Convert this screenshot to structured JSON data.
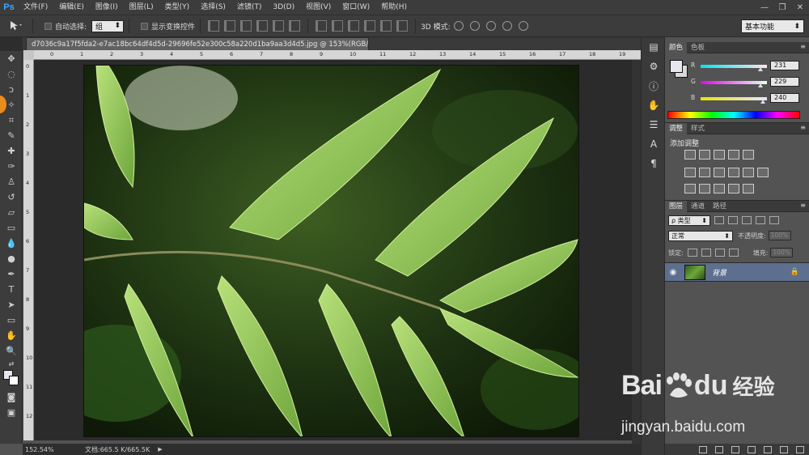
{
  "app": {
    "logo": "Ps",
    "menu": [
      "文件(F)",
      "编辑(E)",
      "图像(I)",
      "图层(L)",
      "类型(Y)",
      "选择(S)",
      "滤镜(T)",
      "3D(D)",
      "视图(V)",
      "窗口(W)",
      "帮助(H)"
    ],
    "window_controls": [
      "—",
      "❐",
      "✕"
    ]
  },
  "options_bar": {
    "auto_select_label": "自动选择:",
    "auto_select_value": "组",
    "show_transform_label": "显示变换控件",
    "mode_3d_label": "3D 模式:",
    "workspace": "基本功能"
  },
  "document": {
    "tab_title": "d7036c9a17f5fda2-e7ac18bc64df4d5d-29696fe52e300c58a220d1ba9aa3d4d5.jpg @ 153%(RGB/8#)",
    "close": "×",
    "zoom": "152.54%",
    "doc_size": "文档:665.5 K/665.5K"
  },
  "ruler": {
    "top_labels": [
      "0",
      "1",
      "2",
      "3",
      "4",
      "5",
      "6",
      "7",
      "8",
      "9",
      "10",
      "11",
      "12",
      "13",
      "14",
      "15",
      "16",
      "17",
      "18",
      "19",
      "20"
    ],
    "left_labels": [
      "0",
      "1",
      "2",
      "3",
      "4",
      "5",
      "6",
      "7",
      "8",
      "9",
      "10",
      "11",
      "12",
      "13"
    ]
  },
  "panels": {
    "color_tabs": [
      "颜色",
      "色板"
    ],
    "rgb": [
      {
        "label": "R",
        "value": "231",
        "fraction": 0.906,
        "gradient": "linear-gradient(to right,#00e5f0,#ffe5f0)"
      },
      {
        "label": "G",
        "value": "229",
        "fraction": 0.898,
        "gradient": "linear-gradient(to right,#e700f0,#e7fff0)"
      },
      {
        "label": "B",
        "value": "240",
        "fraction": 0.941,
        "gradient": "linear-gradient(to right,#e7e500,#e7e5ff)"
      }
    ],
    "adjust_tabs": [
      "调整",
      "样式"
    ],
    "adjust_title": "添加调整",
    "layers_tabs": [
      "图层",
      "通道",
      "路径"
    ],
    "layer_filter": "ρ 类型",
    "blend_mode": "正常",
    "opacity_label": "不透明度:",
    "opacity_value": "100%",
    "lock_label": "锁定:",
    "fill_label": "填充:",
    "fill_value": "100%",
    "layer_name": "背景"
  },
  "watermark": {
    "brand_left": "Bai",
    "brand_right": "du",
    "brand_cn": "经验",
    "url": "jingyan.baidu.com"
  },
  "colors": {
    "foreground": "#e7e5f0",
    "background": "#d8d8d8",
    "layer_selected": "#5e6e8e",
    "accent": "#41a6ff"
  }
}
